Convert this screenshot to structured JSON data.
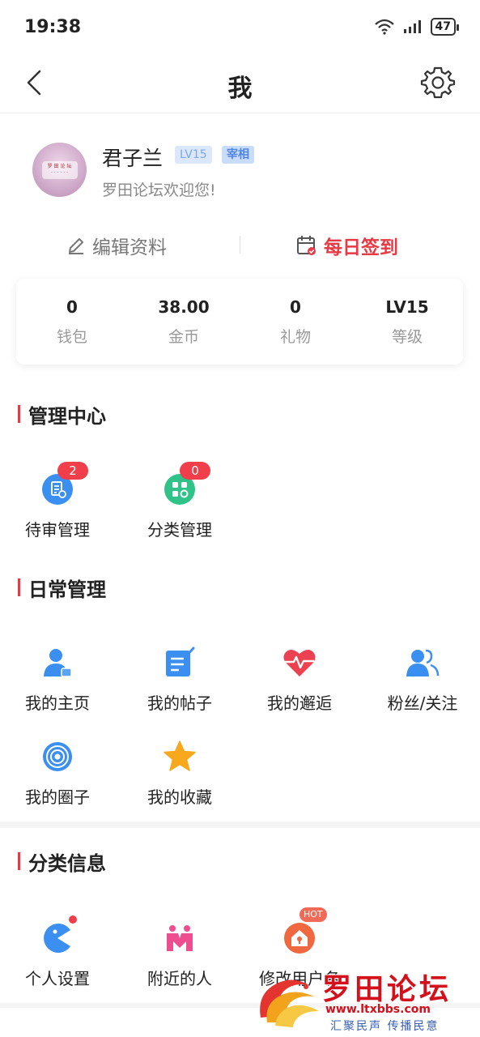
{
  "status_bar": {
    "time": "19:38",
    "battery": "47"
  },
  "nav": {
    "title": "我"
  },
  "profile": {
    "username": "君子兰",
    "level_badge": "LV15",
    "role_badge": "宰相",
    "welcome": "罗田论坛欢迎您!"
  },
  "actions": {
    "edit": "编辑资料",
    "sign_in": "每日签到"
  },
  "stats": [
    {
      "value": "0",
      "label": "钱包"
    },
    {
      "value": "38.00",
      "label": "金币"
    },
    {
      "value": "0",
      "label": "礼物"
    },
    {
      "value": "LV15",
      "label": "等级"
    }
  ],
  "sections": {
    "management": {
      "title": "管理中心",
      "items": [
        {
          "label": "待审管理",
          "icon": "review-icon",
          "badge": "2"
        },
        {
          "label": "分类管理",
          "icon": "category-icon",
          "badge": "0"
        }
      ]
    },
    "daily": {
      "title": "日常管理",
      "items": [
        {
          "label": "我的主页",
          "icon": "user-home-icon"
        },
        {
          "label": "我的帖子",
          "icon": "post-edit-icon"
        },
        {
          "label": "我的邂逅",
          "icon": "heartbeat-icon"
        },
        {
          "label": "粉丝/关注",
          "icon": "followers-icon"
        },
        {
          "label": "我的圈子",
          "icon": "circle-target-icon"
        },
        {
          "label": "我的收藏",
          "icon": "star-icon"
        }
      ]
    },
    "classified": {
      "title": "分类信息",
      "items": [
        {
          "label": "个人设置",
          "icon": "pacman-icon"
        },
        {
          "label": "附近的人",
          "icon": "nearby-people-icon"
        },
        {
          "label": "修改用户名",
          "icon": "house-lock-icon",
          "badge": "HOT"
        }
      ]
    }
  },
  "watermark": {
    "title": "罗田论坛",
    "url": "www.ltxbbs.com",
    "slogan": "汇聚民声 传播民意"
  },
  "colors": {
    "accent": "#e73a45",
    "blue": "#3b8ff0",
    "green": "#2fc38a"
  }
}
